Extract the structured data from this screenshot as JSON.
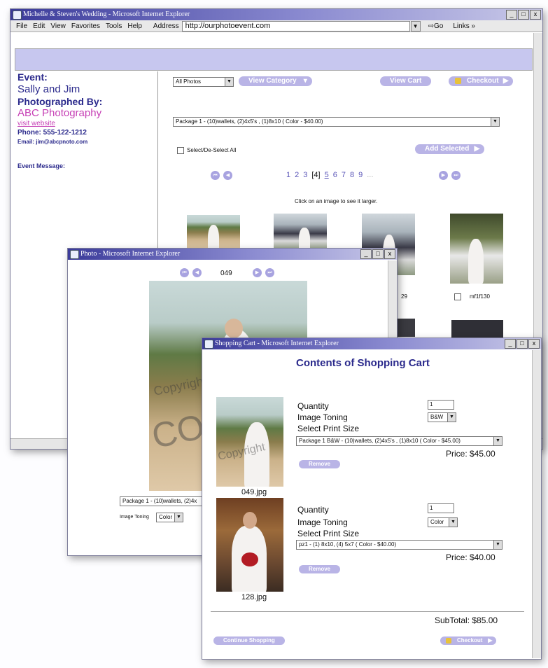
{
  "main_window": {
    "title": "Michelle & Steven's Wedding - Microsoft Internet Explorer",
    "menu": [
      "File",
      "Edit",
      "View",
      "Favorites",
      "Tools",
      "Help"
    ],
    "address_label": "Address",
    "address": "http://ourphotoevent.com",
    "go_label": "Go",
    "links_label": "Links »"
  },
  "sidebar": {
    "event_label": "Event:",
    "event_name": "Sally and Jim",
    "photographed_by_label": "Photographed By:",
    "photographer": "ABC Photography",
    "visit_link": "visit website",
    "phone": "Phone: 555-122-1212",
    "email": "Email: jim@abcpnoto.com",
    "event_message_label": "Event Message:"
  },
  "toolbar": {
    "filter_selected": "All Photos",
    "view_category": "View Category",
    "view_cart": "View Cart",
    "checkout": "Checkout"
  },
  "package_select": "Package 1 - (10)wallets, (2)4x5's , (1)8x10 ( Color - $40.00)",
  "select_all_label": "Select/De-Select All",
  "add_selected": "Add Selected",
  "pagination": [
    "1",
    "2",
    "3",
    "[4]",
    "5",
    "6",
    "7",
    "8",
    "9",
    "..."
  ],
  "gallery_hint": "Click on an image to see it larger.",
  "thumb_captions": [
    "29",
    "mf1f130"
  ],
  "photo_window": {
    "title": "Photo - Microsoft Internet Explorer",
    "photo_number": "049",
    "watermark": "Copyright",
    "watermark_big": "CO",
    "package_select": "Package 1 - (10)wallets, (2)4x",
    "toning_label": "Image Toning",
    "toning_value": "Color"
  },
  "cart_window": {
    "title": "Shopping Cart - Microsoft Internet Explorer",
    "heading": "Contents of Shopping Cart",
    "items": [
      {
        "filename": "049.jpg",
        "quantity_label": "Quantity",
        "quantity": "1",
        "toning_label": "Image Toning",
        "toning": "B&W",
        "size_label": "Select Print Size",
        "size": "Package 1 B&W - (10)wallets, (2)4x5's , (1)8x10 ( Color - $45.00)",
        "price": "Price: $45.00",
        "remove": "Remove",
        "watermark": "Copyright"
      },
      {
        "filename": "128.jpg",
        "quantity_label": "Quantity",
        "quantity": "1",
        "toning_label": "Image Toning",
        "toning": "Color",
        "size_label": "Select Print Size",
        "size": "pz1 - (1) 8x10, (4) 5x7 ( Color - $40.00)",
        "price": "Price: $40.00",
        "remove": "Remove"
      }
    ],
    "subtotal": "SubTotal: $85.00",
    "continue_shopping": "Continue Shopping",
    "checkout": "Checkout"
  },
  "window_buttons": [
    "_",
    "□",
    "x"
  ],
  "colors": {
    "accent": "#b9b4e6",
    "heading": "#2b2a8c",
    "photographer": "#c63fb5",
    "banner": "#c7c7ef"
  }
}
